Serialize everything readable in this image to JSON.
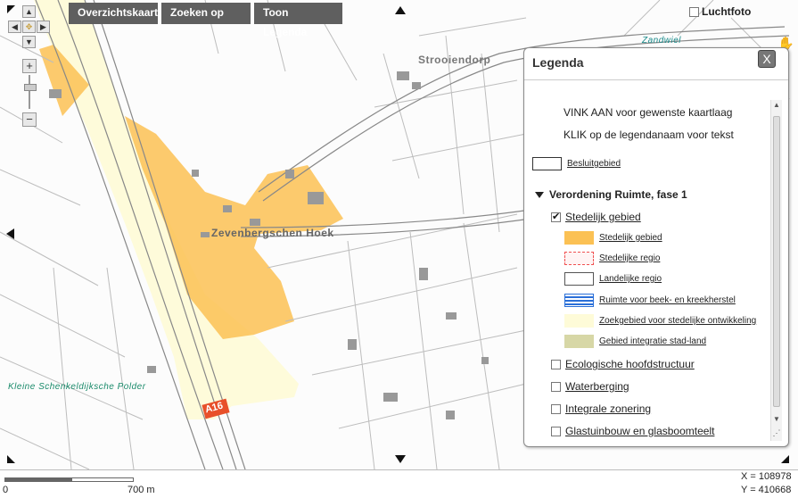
{
  "toolbar": {
    "buttons": [
      "Overzichtskaart",
      "Zoeken op",
      "Toon Legenda"
    ]
  },
  "map": {
    "labels": {
      "strooiendorp": "Strooiendorp",
      "zevenbergschen_hoek": "Zevenbergschen Hoek",
      "zandwiel": "Zandwiel",
      "kleine_polder": "Kleine Schenkeldijksche Polder",
      "road_badge": "A16"
    },
    "zoom_plus": "+",
    "zoom_minus": "−"
  },
  "luchtfoto": {
    "label": "Luchtfoto",
    "checked": false
  },
  "legenda": {
    "title": "Legenda",
    "close": "X",
    "info": [
      "VINK AAN voor gewenste kaartlaag",
      "KLIK op de legendanaam voor tekst"
    ],
    "besluitgebied": "Besluitgebied",
    "group_title": "Verordening Ruimte, fase 1",
    "stedelijk_gebied": {
      "label": "Stedelijk gebied",
      "checked": true
    },
    "sublayers": [
      {
        "label": "Stedelijk gebied",
        "fill": "#fbc154",
        "border": "#fbc154",
        "style": "solid"
      },
      {
        "label": "Stedelijke regio",
        "fill": "#fff4f4",
        "border": "#f05050",
        "style": "dashed"
      },
      {
        "label": "Landelijke regio",
        "fill": "#ffffff",
        "border": "#555555",
        "style": "solid"
      },
      {
        "label": "Ruimte voor beek- en kreekherstel",
        "fill": "stripes",
        "border": "#2a6fd8",
        "style": "solid"
      },
      {
        "label": "Zoekgebied voor stedelijke ontwikkeling",
        "fill": "#fefbd8",
        "border": "#fefbd8",
        "style": "solid"
      },
      {
        "label": "Gebied integratie stad-land",
        "fill": "#d7d7a6",
        "border": "#d7d7a6",
        "style": "solid"
      }
    ],
    "layers": [
      {
        "label": "Ecologische hoofdstructuur",
        "checked": false
      },
      {
        "label": "Waterberging",
        "checked": false
      },
      {
        "label": "Integrale zonering",
        "checked": false
      },
      {
        "label": "Glastuinbouw en glasboomteelt",
        "checked": false
      }
    ]
  },
  "footer": {
    "scale_start": "0",
    "scale_end": "700 m",
    "x_coord": "X = 108978",
    "y_coord": "Y = 410668"
  },
  "colors": {
    "urban": "#fbc154",
    "search_zone": "#fefbd8",
    "toolbar_bg": "#5f5f5f",
    "road_badge": "#e8502a"
  }
}
